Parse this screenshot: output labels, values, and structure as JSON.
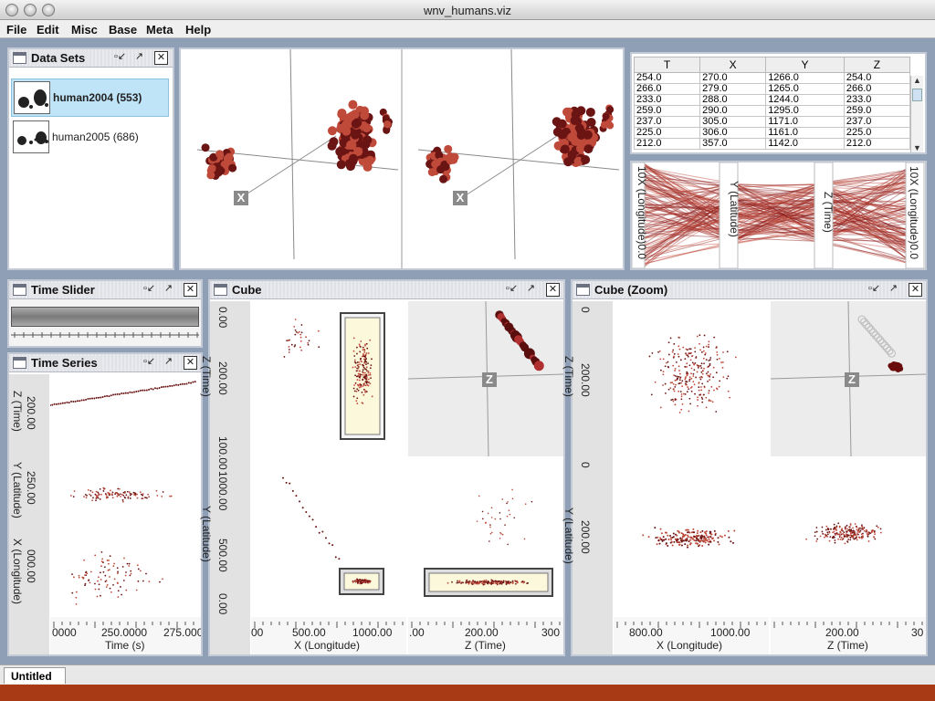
{
  "window": {
    "title": "wnv_humans.viz"
  },
  "menu": [
    "File",
    "Edit",
    "Misc",
    "Base",
    "Meta",
    "Help"
  ],
  "datasets": {
    "title": "Data Sets",
    "items": [
      {
        "label": "human2004 (553)",
        "selected": true
      },
      {
        "label": "human2005 (686)",
        "selected": false
      }
    ]
  },
  "table": {
    "columns": [
      "T",
      "X",
      "Y",
      "Z"
    ],
    "rows": [
      [
        "254.0",
        "270.0",
        "1266.0",
        "254.0"
      ],
      [
        "266.0",
        "279.0",
        "1265.0",
        "266.0"
      ],
      [
        "233.0",
        "288.0",
        "1244.0",
        "233.0"
      ],
      [
        "259.0",
        "290.0",
        "1295.0",
        "259.0"
      ],
      [
        "237.0",
        "305.0",
        "1171.0",
        "237.0"
      ],
      [
        "225.0",
        "306.0",
        "1161.0",
        "225.0"
      ],
      [
        "212.0",
        "357.0",
        "1142.0",
        "212.0"
      ]
    ]
  },
  "parallel": {
    "axes": [
      "10X (Longitude)0.0",
      "Y (Latitude)",
      "Z (Time)",
      "10X (Longitude)0.0"
    ]
  },
  "stereo": {
    "axis_label": "X"
  },
  "time_slider": {
    "title": "Time Slider"
  },
  "time_series": {
    "title": "Time Series",
    "rows": [
      {
        "ylabel": "Z (Time)",
        "tick": "200.00"
      },
      {
        "ylabel": "Y (Latitude)",
        "tick": "250.00"
      },
      {
        "ylabel": "X (Longitude)",
        "tick": "000.00"
      }
    ],
    "xticks": [
      "0000",
      "250.0000",
      "275.000"
    ],
    "xlabel": "Time (s)"
  },
  "cube": {
    "title": "Cube",
    "z_label": "Z (Time)",
    "z_ticks": [
      "0.00",
      "200.00",
      "100.00"
    ],
    "y_label": "Y (Latitude)",
    "y_ticks": [
      "1000.00",
      "500.00",
      "0.00"
    ],
    "x_label": "X (Longitude)",
    "x_ticks": [
      "00",
      "500.00",
      "1000.00"
    ],
    "zx_label": "Z (Time)",
    "zx_ticks": [
      ".00",
      "200.00",
      "300"
    ],
    "axis_box": "Z"
  },
  "cube_zoom": {
    "title": "Cube (Zoom)",
    "z_label": "Z (Time)",
    "z_ticks": [
      "0",
      "200.00"
    ],
    "y_label": "Y (Latitude)",
    "y_ticks": [
      "0",
      "200.00"
    ],
    "x_label": "X (Longitude)",
    "x_ticks": [
      "800.00",
      "1000.00"
    ],
    "zx_label": "Z (Time)",
    "zx_ticks": [
      "200.00",
      "30"
    ],
    "axis_box": "Z"
  },
  "tabs": [
    "Untitled"
  ],
  "colors": {
    "desktop": "#8f9fb6",
    "point_dark": "#6a1414",
    "point_light": "#c04a3a",
    "selection_fill": "#fbf8dc"
  }
}
